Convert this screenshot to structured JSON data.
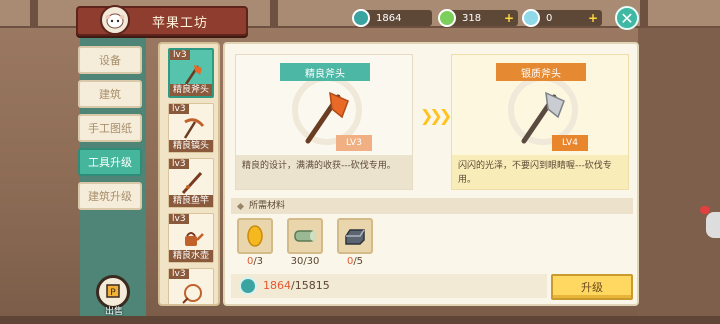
{
  "title": "苹果工坊",
  "resources": [
    {
      "icon": "teal-coin-icon",
      "value": "1864",
      "plus": false
    },
    {
      "icon": "green-gem-icon",
      "value": "318",
      "plus": true
    },
    {
      "icon": "crystal-icon",
      "value": "0",
      "plus": true
    }
  ],
  "tabs": [
    {
      "label": "设备",
      "active": false
    },
    {
      "label": "建筑",
      "active": false
    },
    {
      "label": "手工图纸",
      "active": false
    },
    {
      "label": "工具升级",
      "active": true
    },
    {
      "label": "建筑升级",
      "active": false
    }
  ],
  "sell_label": "出售",
  "tool_list": [
    {
      "lv": "lv3",
      "name": "精良斧头",
      "icon": "axe-icon",
      "selected": true
    },
    {
      "lv": "lv3",
      "name": "精良镐头",
      "icon": "pickaxe-icon",
      "selected": false
    },
    {
      "lv": "lv3",
      "name": "精良鱼竿",
      "icon": "fishing-rod-icon",
      "selected": false
    },
    {
      "lv": "lv3",
      "name": "精良水壶",
      "icon": "watering-can-icon",
      "selected": false
    },
    {
      "lv": "lv3",
      "name": "",
      "icon": "net-icon",
      "selected": false
    }
  ],
  "current_tool": {
    "name": "精良斧头",
    "level": "LV3",
    "description": "精良的设计，满满的收获---砍伐专用。"
  },
  "next_tool": {
    "name": "银质斧头",
    "level": "LV4",
    "description": "闪闪的光泽，不要闪到眼睛喔---砍伐专用。"
  },
  "materials_header": "所需材料",
  "materials": [
    {
      "icon": "golden-seed-icon",
      "have": "0",
      "need": "/3",
      "sufficient": false
    },
    {
      "icon": "log-icon",
      "have": "30",
      "need": "/30",
      "sufficient": true
    },
    {
      "icon": "iron-ingot-icon",
      "have": "0",
      "need": "/5",
      "sufficient": false
    }
  ],
  "cost": {
    "have": "1864",
    "need": "/15815"
  },
  "upgrade_label": "升级",
  "colors": {
    "accent": "#45b69c",
    "button": "#ffd862",
    "lack": "#e4592f"
  }
}
